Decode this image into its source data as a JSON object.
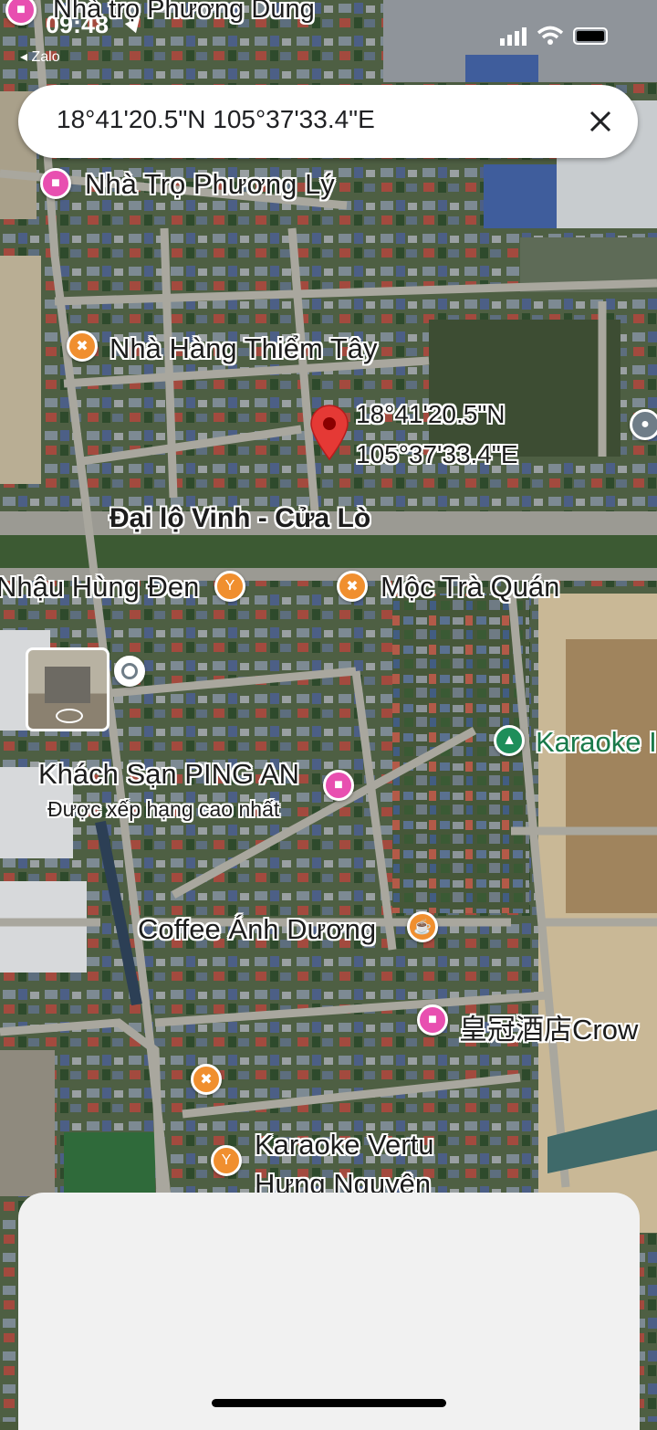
{
  "status_bar": {
    "time": "09:48",
    "back_app": "◂ Zalo",
    "signal_icon": "signal-bars-icon",
    "wifi_icon": "wifi-icon",
    "battery_icon": "battery-icon"
  },
  "search": {
    "query": "18°41'20.5\"N 105°37'33.4\"E",
    "clear_icon": "close-icon"
  },
  "pin": {
    "lat": "18°41'20.5\"N",
    "lng": "105°37'33.4\"E"
  },
  "road": {
    "name": "Đại lộ Vinh - Cửa Lò"
  },
  "places": {
    "p1": "Nhà trọ Phương Dung",
    "p2": "Nhà Trọ Phương Lý",
    "p3": "Nhà Hàng Thiểm Tây",
    "p4": "Nhậu Hùng Đen",
    "p5": "Mộc Trà Quán",
    "p6": "Karaoke I",
    "p7": "Khách Sạn PING AN",
    "p7_sub": "Được xếp hạng cao nhất",
    "p8": "Coffee Ánh Dương",
    "p9": "皇冠酒店Crow",
    "p10_line1": "Karaoke Vertu",
    "p10_line2": "Hưng Nguyên"
  },
  "colors": {
    "restaurant": "#f08f2f",
    "lodging": "#e84fb0",
    "park": "#1e8e5a",
    "pin": "#e53935"
  }
}
